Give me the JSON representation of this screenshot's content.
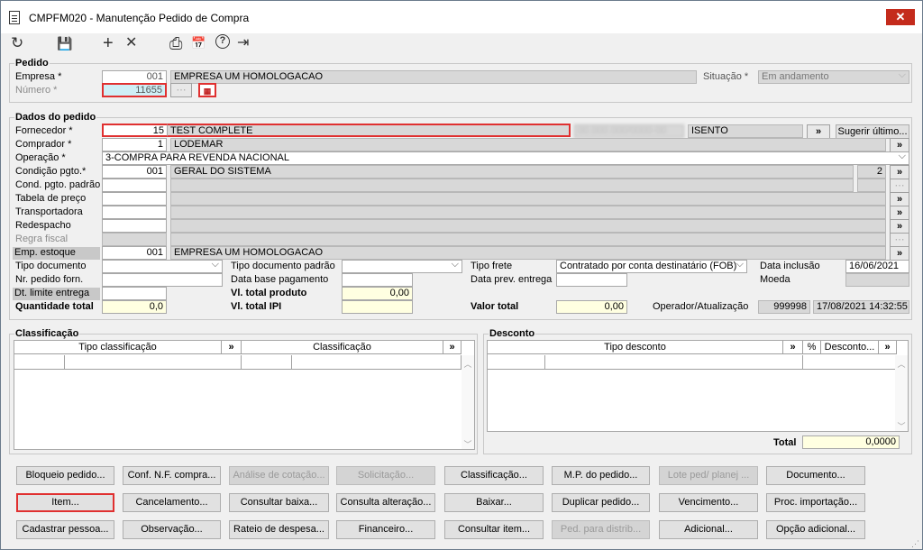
{
  "window": {
    "title": "CMPFM020 - Manutenção Pedido de Compra",
    "close": "✕"
  },
  "toolbar": {
    "refresh": "↻",
    "save": "💾",
    "add": "+",
    "delete": "✕",
    "print": "⎙",
    "calendar": "📅",
    "help": "?",
    "exit": "⇥"
  },
  "pedido": {
    "title": "Pedido",
    "empresa_label": "Empresa *",
    "empresa_code": "001",
    "empresa_name": "EMPRESA UM HOMOLOGACAO",
    "numero_label": "Número *",
    "numero_value": "11655",
    "situacao_label": "Situação *",
    "situacao_value": "Em andamento"
  },
  "dados": {
    "title": "Dados do pedido",
    "fornecedor_label": "Fornecedor *",
    "fornecedor_code": "15",
    "fornecedor_name": "TEST COMPLETE",
    "fornecedor_doc": "00.000.000/0000-00",
    "isento": "ISENTO",
    "sugerir": "Sugerir último...",
    "comprador_label": "Comprador *",
    "comprador_code": "1",
    "comprador_name": "LODEMAR",
    "operacao_label": "Operação *",
    "operacao_value": "3-COMPRA PARA REVENDA NACIONAL",
    "condicao_label": "Condição pgto.*",
    "condicao_code": "001",
    "condicao_name": "GERAL DO SISTEMA",
    "condicao_parcelas": "2",
    "cond_padrao_label": "Cond. pgto. padrão",
    "tabela_label": "Tabela de preço",
    "transportadora_label": "Transportadora",
    "redespacho_label": "Redespacho",
    "regra_label": "Regra fiscal",
    "emp_estoque_label": "Emp. estoque",
    "emp_estoque_code": "001",
    "emp_estoque_name": "EMPRESA UM HOMOLOGACAO",
    "tipo_doc_label": "Tipo documento",
    "tipo_doc_padrao_label": "Tipo documento padrão",
    "tipo_frete_label": "Tipo frete",
    "tipo_frete_value": "Contratado por conta destinatário (FOB)",
    "data_inclusao_label": "Data inclusão",
    "data_inclusao_value": "16/06/2021",
    "nr_pedido_label": "Nr. pedido forn.",
    "data_base_label": "Data base pagamento",
    "data_prev_label": "Data prev. entrega",
    "moeda_label": "Moeda",
    "dt_limite_label": "Dt. limite entrega",
    "vl_total_produto_label": "Vl. total produto",
    "vl_total_produto_value": "0,00",
    "quantidade_label": "Quantidade total",
    "quantidade_value": "0,0",
    "vl_total_ipi_label": "Vl. total IPI",
    "valor_total_label": "Valor total",
    "valor_total_value": "0,00",
    "operador_label": "Operador/Atualização",
    "operador_value": "999998",
    "atualizacao_value": "17/08/2021 14:32:55"
  },
  "classificacao": {
    "title": "Classificação",
    "col1": "Tipo classificação",
    "col2": "Classificação",
    "more": "»"
  },
  "desconto": {
    "title": "Desconto",
    "col1": "Tipo desconto",
    "col2": "%",
    "col3": "Desconto...",
    "more": "»",
    "total_label": "Total",
    "total_value": "0,0000"
  },
  "buttons": {
    "row1": [
      "Bloqueio pedido...",
      "Conf. N.F. compra...",
      "Análise de cotação...",
      "Solicitação...",
      "Classificação...",
      "M.P. do pedido...",
      "Lote ped/ planej ...",
      "Documento..."
    ],
    "row2": [
      "Item...",
      "Cancelamento...",
      "Consultar baixa...",
      "Consulta alteração...",
      "Baixar...",
      "Duplicar pedido...",
      "Vencimento...",
      "Proc. importação..."
    ],
    "row3": [
      "Cadastrar pessoa...",
      "Observação...",
      "Rateio de despesa...",
      "Financeiro...",
      "Consultar item...",
      "Ped. para distrib...",
      "Adicional...",
      "Opção adicional..."
    ]
  }
}
